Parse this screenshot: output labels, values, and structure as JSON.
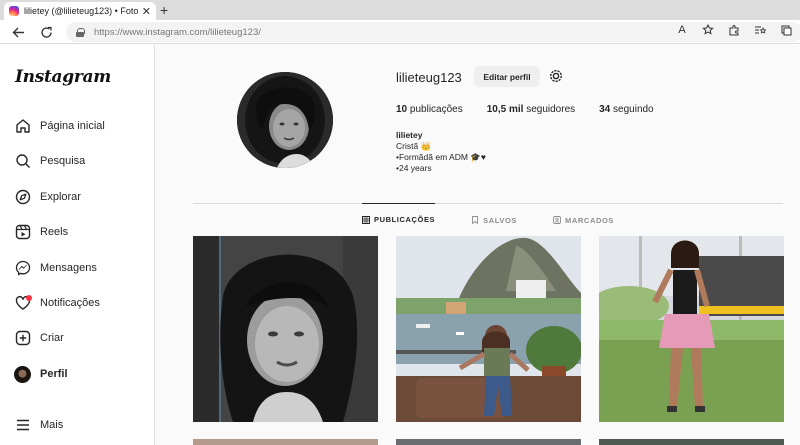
{
  "browser": {
    "tab_title": "lilietey (@lilieteug123) • Fotos e v",
    "tab_close": "✕",
    "new_tab": "+",
    "url_prefix": "https://www.instagram.com/",
    "url_path": "lilieteug123/",
    "zoom_indicator": "A"
  },
  "sidebar": {
    "logo": "Instagram",
    "items": [
      {
        "label": "Página inicial",
        "icon": "home-icon"
      },
      {
        "label": "Pesquisa",
        "icon": "search-icon"
      },
      {
        "label": "Explorar",
        "icon": "compass-icon"
      },
      {
        "label": "Reels",
        "icon": "reels-icon"
      },
      {
        "label": "Mensagens",
        "icon": "messenger-icon"
      },
      {
        "label": "Notificações",
        "icon": "heart-icon"
      },
      {
        "label": "Criar",
        "icon": "plus-square-icon"
      },
      {
        "label": "Perfil",
        "icon": "avatar"
      }
    ],
    "more_label": "Mais"
  },
  "profile": {
    "username": "lilieteug123",
    "edit_label": "Editar perfil",
    "stats": [
      {
        "value": "10",
        "label": "publicações"
      },
      {
        "value": "10,5 mil",
        "label": "seguidores"
      },
      {
        "value": "34",
        "label": "seguindo"
      }
    ],
    "bio": {
      "name": "lilietey",
      "lines": [
        "Cristã 👑",
        "•Formãdã em ADM 🎓♥",
        "•24 years"
      ]
    }
  },
  "tabs": [
    {
      "label": "PUBLICAÇÕES",
      "icon": "grid-icon",
      "active": true
    },
    {
      "label": "SALVOS",
      "icon": "bookmark-icon",
      "active": false
    },
    {
      "label": "MARCADOS",
      "icon": "tagged-icon",
      "active": false
    }
  ],
  "colors": {
    "notification_dot": "#ff3040",
    "border": "#dbdbdb",
    "text": "#262626"
  }
}
